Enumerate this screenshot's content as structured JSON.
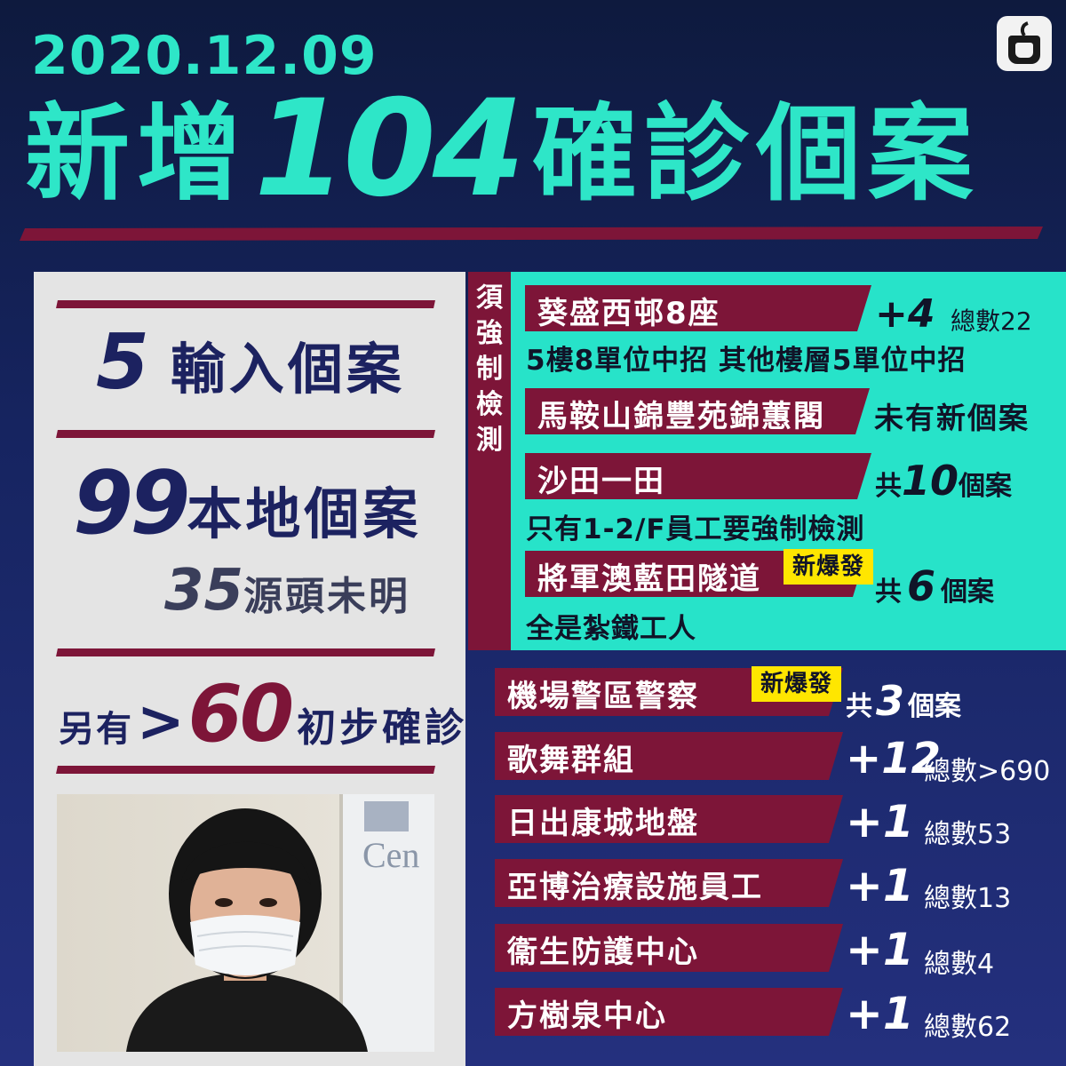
{
  "header": {
    "date": "2020.12.09",
    "title_pre": "新增",
    "title_num": "104",
    "title_post": "確診個案"
  },
  "summary": {
    "imported_num": "5",
    "imported_label": "輸入個案",
    "local_num": "99",
    "local_label": "本地個案",
    "unknown_num": "35",
    "unknown_label": "源頭未明",
    "prelim_prefix": "另有",
    "prelim_sign": ">",
    "prelim_num": "60",
    "prelim_label": "初步確診"
  },
  "mandatory": {
    "label": "須強制檢測",
    "items": [
      {
        "name": "葵盛西邨8座",
        "delta": "+4",
        "total": "總數22",
        "note": "5樓8單位中招 其他樓層5單位中招"
      },
      {
        "name": "馬鞍山錦豐苑錦蕙閣",
        "status": "未有新個案"
      },
      {
        "name": "沙田一田",
        "count_prefix": "共",
        "count": "10",
        "count_suffix": "個案",
        "note": "只有1-2/F員工要強制檢測"
      },
      {
        "name": "將軍澳藍田隧道",
        "badge": "新爆發",
        "count_prefix": "共",
        "count": "6",
        "count_suffix": "個案",
        "note": "全是紮鐵工人"
      }
    ]
  },
  "clusters": [
    {
      "name": "機場警區警察",
      "badge": "新爆發",
      "count_prefix": "共",
      "count": "3",
      "count_suffix": "個案"
    },
    {
      "name": "歌舞群組",
      "delta": "+12",
      "total": "總數>690"
    },
    {
      "name": "日出康城地盤",
      "delta": "+1",
      "total": "總數53"
    },
    {
      "name": "亞博治療設施員工",
      "delta": "+1",
      "total": "總數13"
    },
    {
      "name": "衞生防護中心",
      "delta": "+1",
      "total": "總數4"
    },
    {
      "name": "方樹泉中心",
      "delta": "+1",
      "total": "總數62"
    }
  ],
  "photo": {
    "sign_text": "Cen"
  },
  "colors": {
    "accent": "#2ee6c8",
    "maroon": "#7d1538",
    "navy": "#1c2260",
    "highlight": "#ffe600"
  },
  "icons": {
    "logo": "apple-logo-icon"
  }
}
